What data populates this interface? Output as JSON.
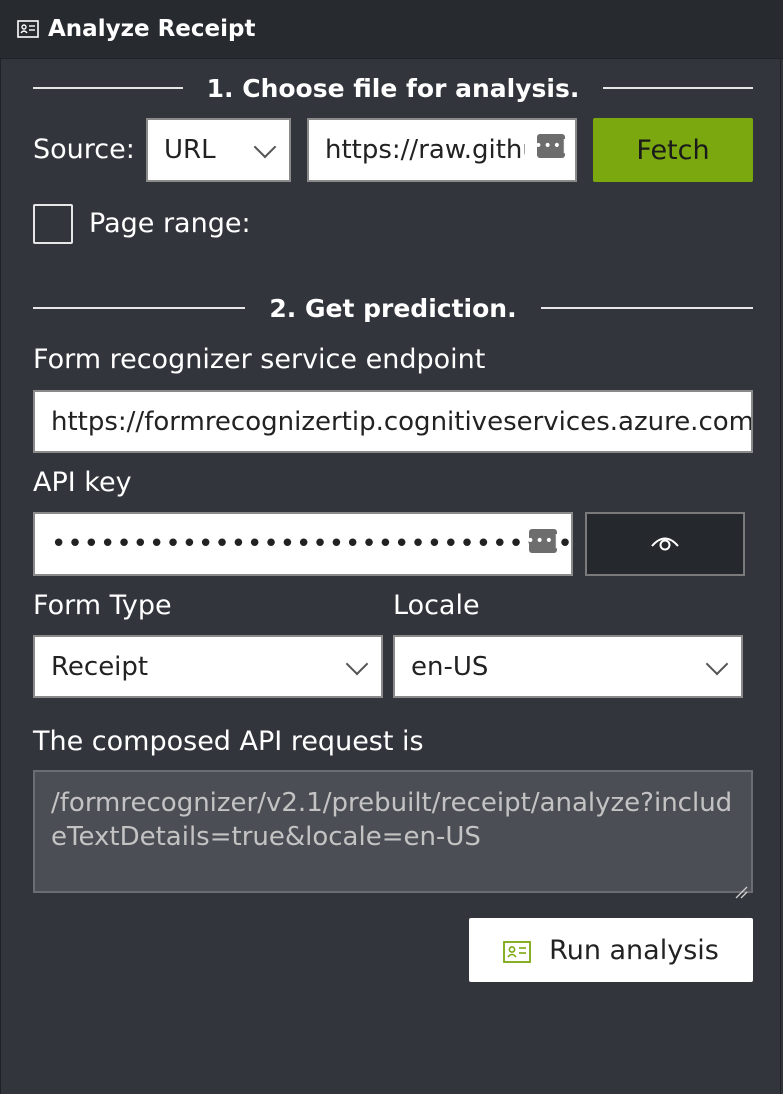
{
  "window": {
    "title": "Analyze Receipt",
    "icon": "id-card-icon"
  },
  "section1": {
    "heading": "1. Choose file for analysis."
  },
  "source": {
    "label": "Source:",
    "type_value": "URL",
    "url_value": "https://raw.githu...",
    "fetch_label": "Fetch"
  },
  "page_range": {
    "label": "Page range:",
    "checked": false
  },
  "section2": {
    "heading": "2. Get prediction."
  },
  "endpoint": {
    "label": "Form recognizer service endpoint",
    "value": "https://formrecognizertip.cognitiveservices.azure.com/"
  },
  "api_key": {
    "label": "API key",
    "value": "••••••••••••••••••••••••••••••••",
    "toggle_icon": "eye-icon"
  },
  "form_type": {
    "label": "Form Type",
    "value": "Receipt"
  },
  "locale": {
    "label": "Locale",
    "value": "en-US"
  },
  "request": {
    "label": "The composed API request is",
    "value": "/formrecognizer/v2.1/prebuilt/receipt/analyze?includeTextDetails=true&locale=en-US"
  },
  "run": {
    "label": "Run analysis",
    "icon": "id-card-icon"
  },
  "colors": {
    "background": "#32363c",
    "titlebar": "#272b30",
    "accent_green": "#7ba70f",
    "text": "#ffffff"
  }
}
